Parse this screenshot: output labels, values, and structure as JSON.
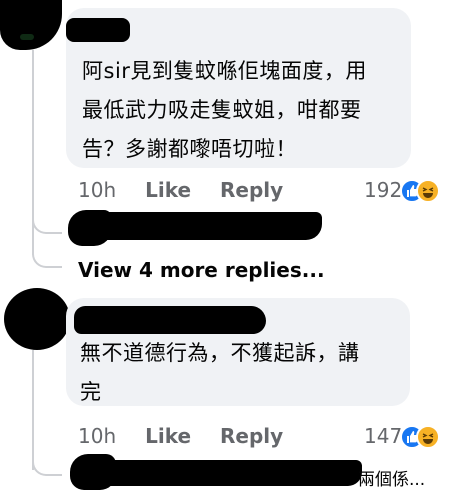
{
  "comments": [
    {
      "text": "阿sir見到隻蚊喺佢塊面度，用\n最低武力吸走隻蚊姐，咁都要\n告？多謝都嚟唔切啦！",
      "time": "10h",
      "like_label": "Like",
      "reply_label": "Reply",
      "reaction_count": "192"
    },
    {
      "text": "無不道德行為，不獲起訴，講\n完",
      "time": "10h",
      "like_label": "Like",
      "reply_label": "Reply",
      "reaction_count": "147"
    }
  ],
  "view_more_replies": "View 4 more replies...",
  "reply_snippet": "兩個係...",
  "colors": {
    "bubble": "#f0f2f5",
    "meta_text": "#65676b",
    "like_blue": "#1877f2",
    "haha_yellow": "#f7b125"
  },
  "icons": [
    "like-reaction-icon",
    "haha-reaction-icon"
  ]
}
